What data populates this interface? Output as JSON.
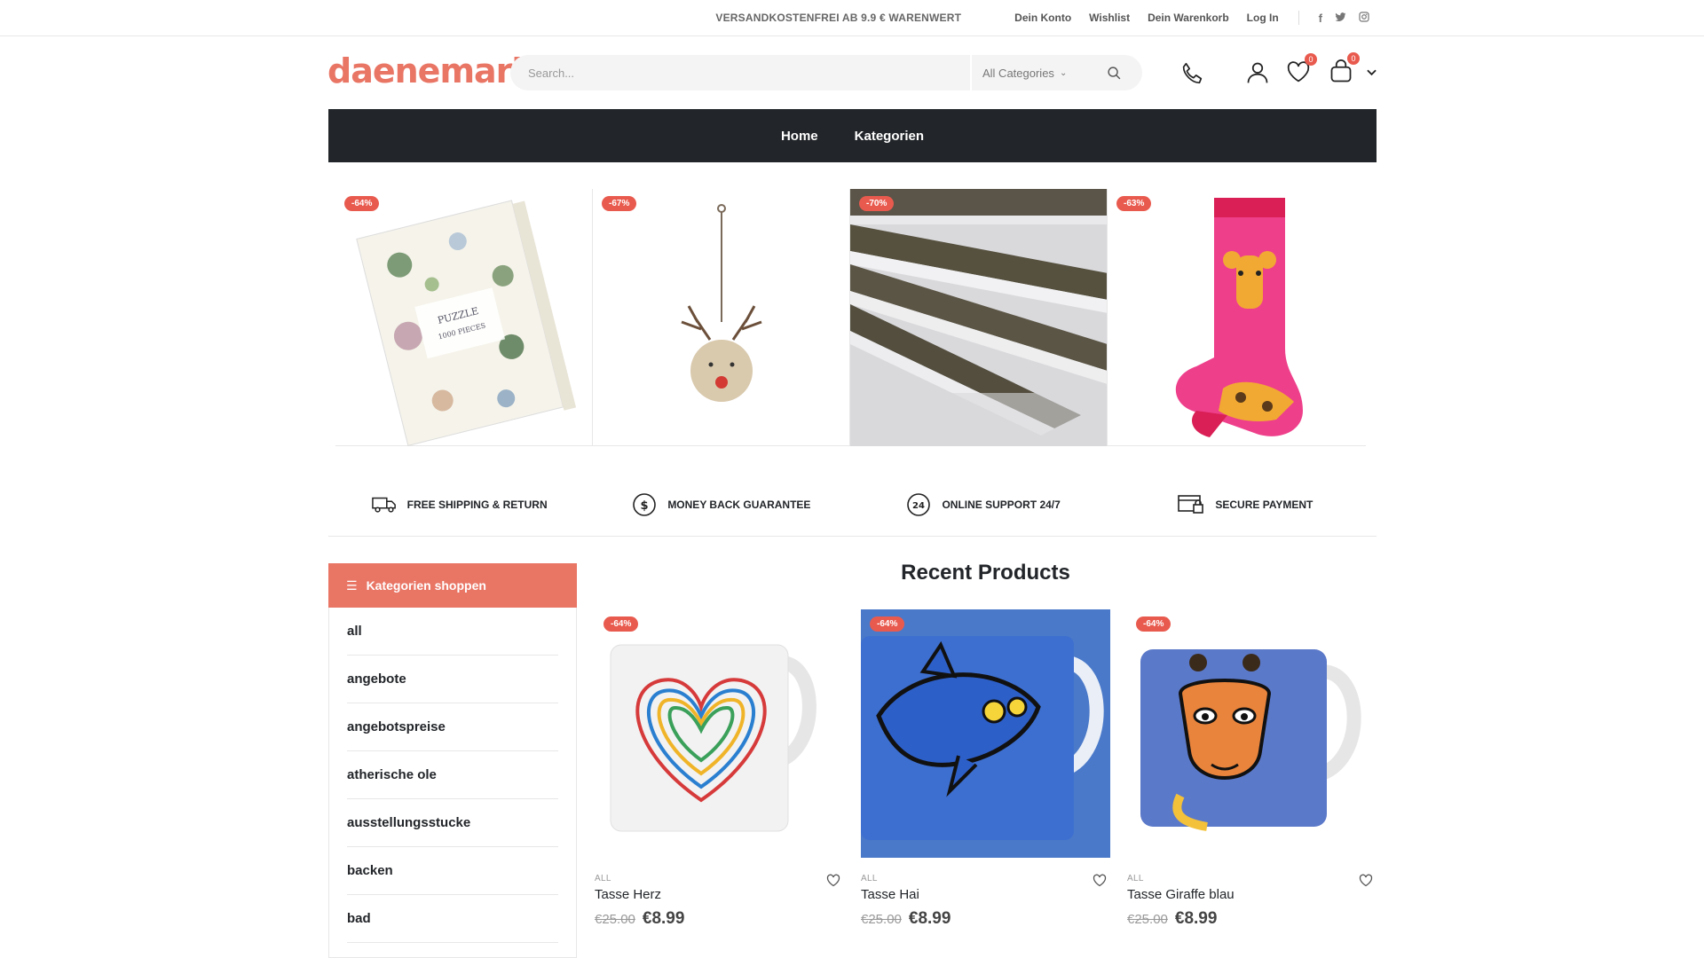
{
  "topbar": {
    "promo": "VERSANDKOSTENFREI AB 9.9 € WARENWERT",
    "links": [
      "Dein Konto",
      "Wishlist",
      "Dein Warenkorb",
      "Log In"
    ],
    "social": [
      "facebook-icon",
      "twitter-icon",
      "instagram-icon"
    ]
  },
  "header": {
    "logo": "daenemark",
    "search_placeholder": "Search...",
    "category_select": "All Categories",
    "wishlist_count": "0",
    "cart_count": "0"
  },
  "nav": {
    "items": [
      "Home",
      "Kategorien"
    ]
  },
  "banner": {
    "items": [
      {
        "discount": "-64%"
      },
      {
        "discount": "-67%"
      },
      {
        "discount": "-70%"
      },
      {
        "discount": "-63%"
      }
    ]
  },
  "features": [
    {
      "icon": "truck-icon",
      "label": "FREE SHIPPING & RETURN"
    },
    {
      "icon": "dollar-circle-icon",
      "label": "MONEY BACK GUARANTEE"
    },
    {
      "icon": "support-24-icon",
      "label": "ONLINE SUPPORT 24/7"
    },
    {
      "icon": "secure-payment-icon",
      "label": "SECURE PAYMENT"
    }
  ],
  "sidebar": {
    "title": "Kategorien shoppen",
    "items": [
      "all",
      "angebote",
      "angebotspreise",
      "atherische ole",
      "ausstellungsstucke",
      "backen",
      "bad"
    ]
  },
  "recent": {
    "title": "Recent Products",
    "products": [
      {
        "discount": "-64%",
        "category": "ALL",
        "name": "Tasse Herz",
        "old_price": "€25.00",
        "price": "€8.99"
      },
      {
        "discount": "-64%",
        "category": "ALL",
        "name": "Tasse Hai",
        "old_price": "€25.00",
        "price": "€8.99"
      },
      {
        "discount": "-64%",
        "category": "ALL",
        "name": "Tasse Giraffe blau",
        "old_price": "€25.00",
        "price": "€8.99"
      }
    ]
  },
  "colors": {
    "accent": "#e97565",
    "badge": "#e95a4e",
    "nav_bg": "#222529"
  }
}
